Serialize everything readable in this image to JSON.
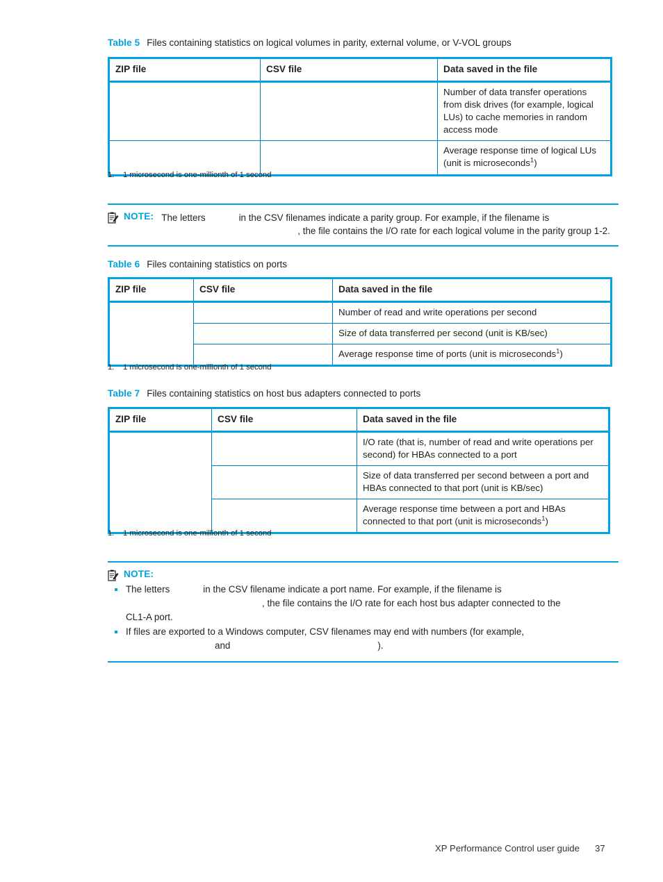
{
  "document": {
    "footer_text": "XP Performance Control user guide",
    "page_number": "37"
  },
  "colors": {
    "accent": "#00a3e0",
    "table_border": "#00a3e0",
    "grid_line": "#0080c0",
    "body_text": "#231f20"
  },
  "table5": {
    "caption_number": "Table 5",
    "caption_text": "Files containing statistics on logical volumes in parity, external volume, or V-VOL groups",
    "headers": [
      "ZIP file",
      "CSV file",
      "Data saved in the file"
    ],
    "rows": [
      {
        "zip": "",
        "csv": "",
        "data": "Number of data transfer operations from disk drives (for example, logical LUs) to cache memories in random access mode"
      },
      {
        "zip": "",
        "csv": "",
        "data": "Average response time of logical LUs (unit is microseconds",
        "data_suffix": ")",
        "footnote_marker": "1"
      }
    ],
    "footnote": {
      "number": "1.",
      "text": "1 microsecond is one-millionth of 1 second"
    }
  },
  "note1": {
    "label": "NOTE:",
    "icon": "note-clipboard-icon",
    "line1_part1": "The letters",
    "line1_part2": "in the CSV filenames indicate a parity group. For example, if the filename is",
    "line2_part1": ", the file contains the I/O rate for each logical volume in the parity group 1-2."
  },
  "table6": {
    "caption_number": "Table 6",
    "caption_text": "Files containing statistics on ports",
    "headers": [
      "ZIP file",
      "CSV file",
      "Data saved in the file"
    ],
    "rows": [
      {
        "zip": "",
        "csv": "",
        "data": "Number of read and write operations per second"
      },
      {
        "zip": "",
        "csv": "",
        "data": "Size of data transferred per second (unit is KB/sec)"
      },
      {
        "zip": "",
        "csv": "",
        "data": "Average response time of ports (unit is microseconds",
        "data_suffix": ")",
        "footnote_marker": "1"
      }
    ],
    "footnote": {
      "number": "1.",
      "text": "1 microsecond is one-millionth of 1 second"
    }
  },
  "table7": {
    "caption_number": "Table 7",
    "caption_text": "Files containing statistics on host bus adapters connected to ports",
    "headers": [
      "ZIP file",
      "CSV file",
      "Data saved in the file"
    ],
    "rows": [
      {
        "zip": "",
        "csv": "",
        "data": "I/O rate (that is, number of read and write operations per second) for HBAs connected to a port"
      },
      {
        "zip": "",
        "csv": "",
        "data": "Size of data transferred per second between a port and HBAs connected to that port (unit is KB/sec)"
      },
      {
        "zip": "",
        "csv": "",
        "data": "Average response time between a port and HBAs connected to that port (unit is microseconds",
        "data_suffix": ")",
        "footnote_marker": "1"
      }
    ],
    "footnote": {
      "number": "1.",
      "text": "1 microsecond is one-millionth of 1 second"
    }
  },
  "note2": {
    "label": "NOTE:",
    "icon": "note-clipboard-icon",
    "bullet1_part1": "The letters",
    "bullet1_part2": "in the CSV filename indicate a port name. For example, if the filename is",
    "bullet1_part3": ", the file contains the I/O rate for each host bus adapter connected to the",
    "bullet1_part4": "CL1-A port.",
    "bullet2_part1": "If files are exported to a Windows computer, CSV filenames may end with numbers (for example,",
    "bullet2_part2": "and",
    "bullet2_part3": ")."
  }
}
